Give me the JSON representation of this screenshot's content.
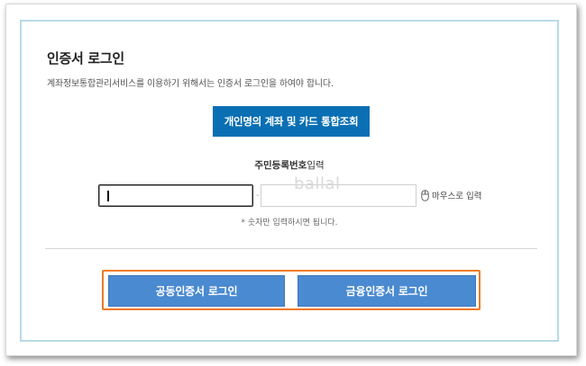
{
  "title": "인증서 로그인",
  "description": "계좌정보통합관리서비스를 이용하기 위해서는 인증서 로그인을 하여야 합니다.",
  "personal_button": "개인명의 계좌 및 카드 통합조회",
  "rrn": {
    "label_bold": "주민등록번호",
    "label_rest": "입력",
    "dash": "-",
    "watermark": "ballal",
    "mouse_input": "마우스로 입력",
    "hint": "* 숫자만 입력하시면 됩니다."
  },
  "login": {
    "joint_label": "공동인증서 로그인",
    "financial_label": "금융인증서 로그인"
  },
  "colors": {
    "primary": "#0a6fb3",
    "login_button": "#4a8ad0",
    "highlight_frame": "#f07a22",
    "panel_border": "#b7dbe8"
  }
}
